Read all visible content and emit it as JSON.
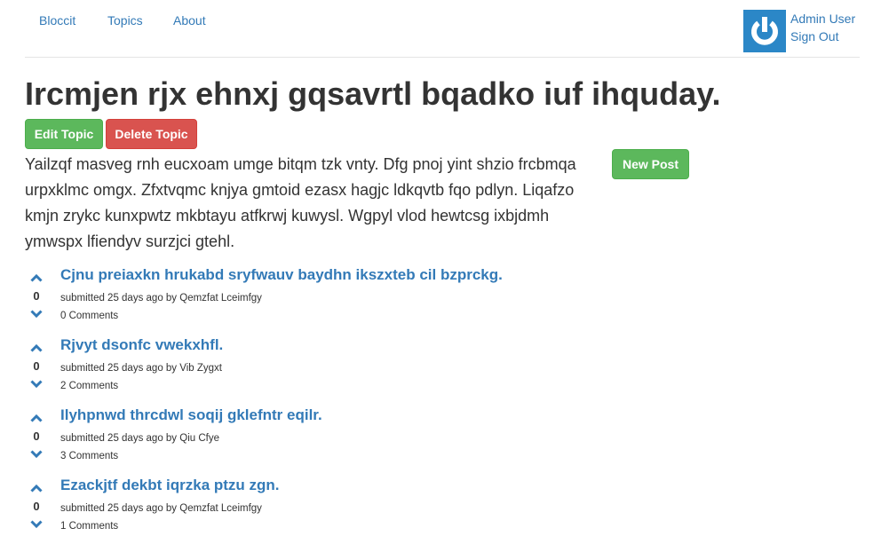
{
  "nav": {
    "brand": "Bloccit",
    "topics": "Topics",
    "about": "About",
    "user_name": "Admin User",
    "sign_out": "Sign Out",
    "avatar_icon": "power-icon"
  },
  "topic": {
    "title": "Ircmjen rjx ehnxj gqsavrtl bqadko iuf ihquday.",
    "description": "Yailzqf masveg rnh eucxoam umge bitqm tzk vnty. Dfg pnoj yint shzio frcbmqa urpxklmc omgx. Zfxtvqmc knjya gmtoid ezasx hagjc ldkqvtb fqo pdlyn. Liqafzo kmjn zrykc kunxpwtz mkbtayu atfkrwj kuwysl. Wgpyl vlod hewtcsg ixbjdmh ymwspx lfiendyv surzjci gtehl.",
    "edit_label": "Edit Topic",
    "delete_label": "Delete Topic",
    "new_post_label": "New Post"
  },
  "posts": [
    {
      "votes": "0",
      "title": "Cjnu preiaxkn hrukabd sryfwauv baydhn ikszxteb cil bzprckg.",
      "meta": "submitted 25 days ago by Qemzfat Lceimfgy",
      "comments": "0 Comments"
    },
    {
      "votes": "0",
      "title": "Rjvyt dsonfc vwekxhfl.",
      "meta": "submitted 25 days ago by Vib Zygxt",
      "comments": "2 Comments"
    },
    {
      "votes": "0",
      "title": "Ilyhpnwd thrcdwl soqij gklefntr eqilr.",
      "meta": "submitted 25 days ago by Qiu Cfye",
      "comments": "3 Comments"
    },
    {
      "votes": "0",
      "title": "Ezackjtf dekbt iqrzka ptzu zgn.",
      "meta": "submitted 25 days ago by Qemzfat Lceimfgy",
      "comments": "1 Comments"
    }
  ],
  "colors": {
    "link": "#337ab7",
    "success": "#5cb85c",
    "danger": "#d9534f",
    "avatar_bg": "#2b87c7"
  }
}
